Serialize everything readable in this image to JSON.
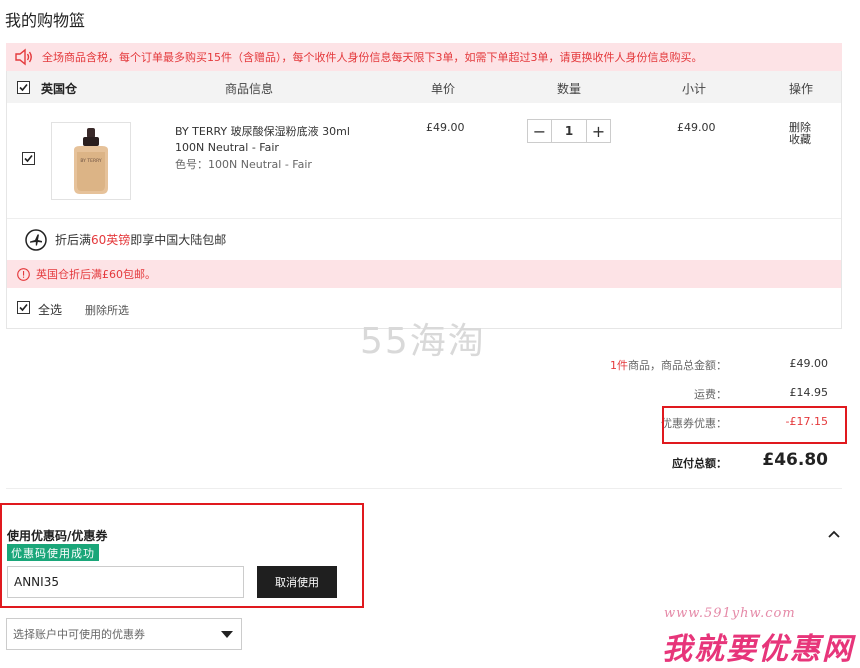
{
  "page": {
    "title": "我的购物篮"
  },
  "notice": {
    "text": "全场商品含税，每个订单最多购买15件（含赠品），每个收件人身份信息每天限下3单，如需下单超过3单，请更换收件人身份信息购买。"
  },
  "table": {
    "headers": {
      "warehouse": "英国仓",
      "product": "商品信息",
      "unit_price": "单价",
      "quantity": "数量",
      "subtotal": "小计",
      "action": "操作"
    }
  },
  "item": {
    "name": "BY TERRY 玻尿酸保湿粉底液 30ml 100N Neutral - Fair",
    "color": "色号：100N Neutral - Fair",
    "price": "£49.00",
    "qty": "1",
    "subtotal": "£49.00",
    "delete": "删除",
    "favorite": "收藏",
    "thumb_brand": "BY TERRY"
  },
  "shipping": {
    "pre": "折后满",
    "amount": "60英镑",
    "post": "即享中国大陆包邮"
  },
  "warning": {
    "text": "英国仓折后满£60包邮。"
  },
  "select_all": {
    "label": "全选",
    "delete_selected": "删除所选"
  },
  "watermark": "55海淘",
  "summary": {
    "count": "1件",
    "count_label": "商品，商品总金额：",
    "goods_amount": "£49.00",
    "shipping_label": "运费：",
    "shipping_amount": "£14.95",
    "coupon_label": "优惠券优惠：",
    "coupon_amount": "-£17.15",
    "total_label": "应付总额：",
    "total_amount": "£46.80"
  },
  "promo": {
    "title": "使用优惠码/优惠券",
    "success": "优惠码使用成功",
    "code": "ANNI35",
    "cancel": "取消使用"
  },
  "coupon_select": {
    "placeholder": "选择账户中可使用的优惠券"
  },
  "site": {
    "url": "www.591yhw.com",
    "logo": "我就要优惠网"
  },
  "colors": {
    "accent_red": "#e4393c",
    "success_green": "#1aa679",
    "dark_button": "#1f1f1f",
    "notice_bg": "#fde3e6"
  }
}
